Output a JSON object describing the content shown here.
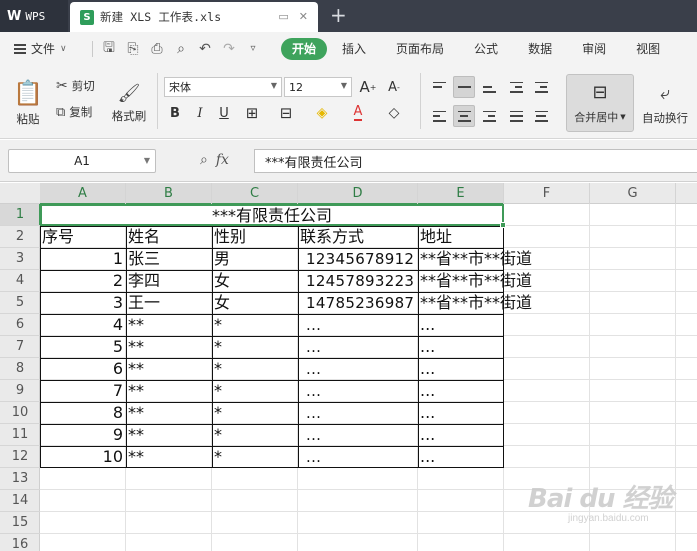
{
  "app": {
    "brand": "WPS",
    "document_tab": "新建 XLS 工作表.xls",
    "new_tab_symbol": "+"
  },
  "menu": {
    "file_label": "文件",
    "tabs": [
      {
        "label": "开始",
        "active": true
      },
      {
        "label": "插入",
        "active": false
      },
      {
        "label": "页面布局",
        "active": false
      },
      {
        "label": "公式",
        "active": false
      },
      {
        "label": "数据",
        "active": false
      },
      {
        "label": "审阅",
        "active": false
      },
      {
        "label": "视图",
        "active": false
      }
    ]
  },
  "ribbon": {
    "paste": "粘贴",
    "cut": "剪切",
    "copy": "复制",
    "format_painter": "格式刷",
    "font_name": "宋体",
    "font_size": "12",
    "merge_center": "合并居中",
    "wrap_text": "自动换行",
    "bold": "B",
    "italic": "I",
    "underline": "U",
    "font_color_letter": "A",
    "grow_font": "A",
    "shrink_font": "A"
  },
  "formula_bar": {
    "name_box": "A1",
    "fx": "fx",
    "content": "***有限责任公司"
  },
  "grid": {
    "columns": [
      "A",
      "B",
      "C",
      "D",
      "E",
      "F",
      "G"
    ],
    "rows": [
      "1",
      "2",
      "3",
      "4",
      "5",
      "6",
      "7",
      "8",
      "9",
      "10",
      "11",
      "12",
      "13",
      "14",
      "15",
      "16"
    ],
    "title": "***有限责任公司",
    "headers": [
      "序号",
      "姓名",
      "性别",
      "联系方式",
      "地址"
    ],
    "data_rows": [
      [
        "1",
        "张三",
        "男",
        "12345678912",
        "**省**市**街道"
      ],
      [
        "2",
        "李四",
        "女",
        "12457893223",
        "**省**市**街道"
      ],
      [
        "3",
        "王一",
        "女",
        "14785236987",
        "**省**市**街道"
      ],
      [
        "4",
        "**",
        "*",
        "...",
        "..."
      ],
      [
        "5",
        "**",
        "*",
        "...",
        "..."
      ],
      [
        "6",
        "**",
        "*",
        "...",
        "..."
      ],
      [
        "7",
        "**",
        "*",
        "...",
        "..."
      ],
      [
        "8",
        "**",
        "*",
        "...",
        "..."
      ],
      [
        "9",
        "**",
        "*",
        "...",
        "..."
      ],
      [
        "10",
        "**",
        "*",
        "...",
        "..."
      ]
    ]
  },
  "watermark": {
    "main": "Bai du 经验",
    "sub": "jingyan.baidu.com"
  },
  "colors": {
    "accent_green": "#3ea35c",
    "titlebar": "#3a3f4a"
  }
}
